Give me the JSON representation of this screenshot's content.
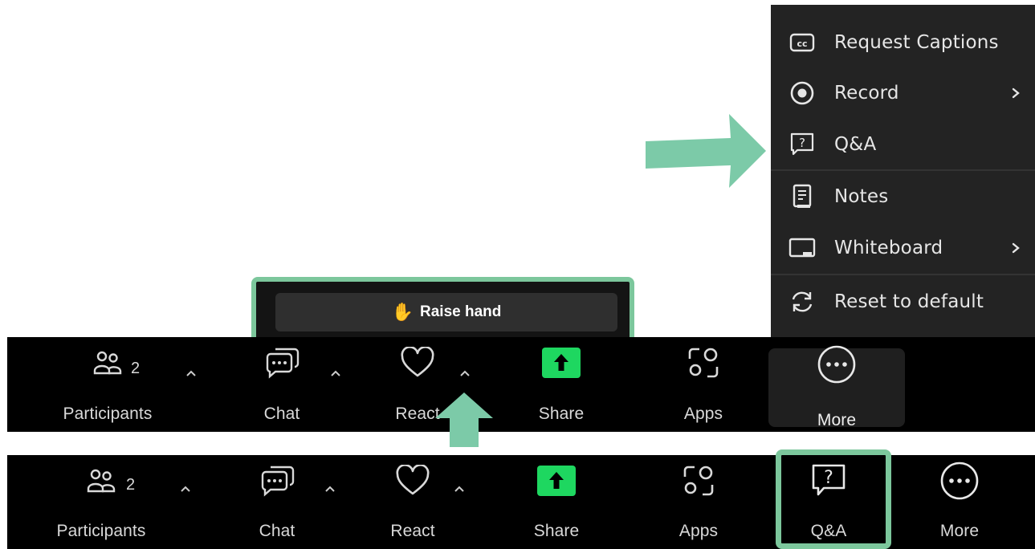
{
  "menu": {
    "items": [
      {
        "label": "Request Captions",
        "icon": "cc-icon",
        "submenu": false
      },
      {
        "label": "Record",
        "icon": "record-icon",
        "submenu": true
      },
      {
        "label": "Q&A",
        "icon": "qa-icon",
        "submenu": false
      },
      {
        "label": "Notes",
        "icon": "notes-icon",
        "submenu": false
      },
      {
        "label": "Whiteboard",
        "icon": "whiteboard-icon",
        "submenu": true
      },
      {
        "label": "Reset to default",
        "icon": "reset-icon",
        "submenu": false
      }
    ]
  },
  "raise_hand": {
    "emoji": "✋",
    "label": "Raise hand"
  },
  "toolbar_top": {
    "participants": {
      "label": "Participants",
      "count": "2"
    },
    "chat": {
      "label": "Chat"
    },
    "react": {
      "label": "React"
    },
    "share": {
      "label": "Share"
    },
    "apps": {
      "label": "Apps"
    },
    "more": {
      "label": "More"
    }
  },
  "toolbar_bottom": {
    "participants": {
      "label": "Participants",
      "count": "2"
    },
    "chat": {
      "label": "Chat"
    },
    "react": {
      "label": "React"
    },
    "share": {
      "label": "Share"
    },
    "apps": {
      "label": "Apps"
    },
    "qa": {
      "label": "Q&A"
    },
    "more": {
      "label": "More"
    }
  },
  "colors": {
    "accent_green": "#7cc79c",
    "share_green": "#1ed760",
    "arrow_green": "#7ccaa8",
    "toolbar_bg": "#000000",
    "menu_bg": "#232323"
  }
}
